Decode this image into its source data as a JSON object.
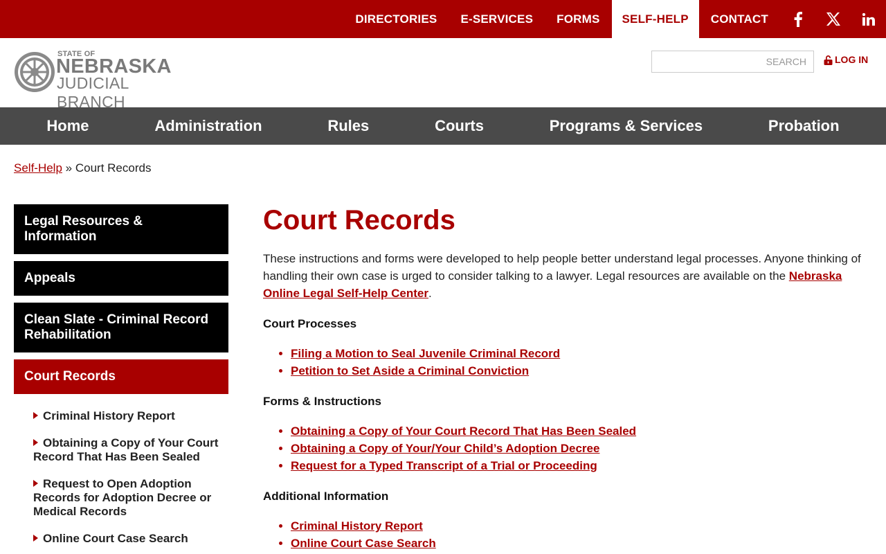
{
  "topnav": {
    "items": [
      "DIRECTORIES",
      "E-SERVICES",
      "FORMS",
      "SELF-HELP",
      "CONTACT"
    ],
    "active": "SELF-HELP",
    "social": [
      "facebook-icon",
      "x-twitter-icon",
      "linkedin-icon"
    ]
  },
  "logo": {
    "small": "STATE OF",
    "big": "NEBRASKA",
    "sub": "JUDICIAL BRANCH"
  },
  "search": {
    "placeholder": "SEARCH"
  },
  "login": {
    "label": "LOG IN",
    "icon": "lock-icon"
  },
  "mainnav": [
    "Home",
    "Administration",
    "Rules",
    "Courts",
    "Programs & Services",
    "Probation"
  ],
  "breadcrumb": {
    "parent": "Self-Help",
    "separator": "»",
    "current": "Court Records"
  },
  "sidebar": {
    "items": [
      "Legal Resources & Information",
      "Appeals",
      "Clean Slate - Criminal Record Rehabilitation",
      "Court Records"
    ],
    "active": "Court Records",
    "subitems": [
      "Criminal History Report",
      "Obtaining a Copy of Your Court Record That Has Been Sealed",
      "Request to Open Adoption Records for Adoption Decree or Medical Records",
      "Online Court Case Search"
    ]
  },
  "content": {
    "title": "Court Records",
    "intro_text": "These instructions and forms were developed to help people better understand legal processes. Anyone thinking of handling their own case is urged to consider talking to a lawyer. Legal resources are available on the ",
    "intro_link": "Nebraska Online Legal Self-Help Center",
    "intro_end": ".",
    "sections": [
      {
        "heading": "Court Processes",
        "links": [
          "Filing a Motion to Seal Juvenile Criminal Record",
          "Petition to Set Aside a Criminal Conviction"
        ]
      },
      {
        "heading": "Forms & Instructions",
        "links": [
          "Obtaining a Copy of Your Court Record That Has Been Sealed",
          "Obtaining a Copy of Your/Your Child’s Adoption Decree",
          "Request for a Typed Transcript of a Trial or Proceeding"
        ]
      },
      {
        "heading": "Additional Information",
        "links": [
          "Criminal History Report",
          "Online Court Case Search"
        ]
      }
    ]
  },
  "colors": {
    "brand": "#a80000",
    "nav": "#4a4a4a",
    "sidebar": "#000000"
  }
}
